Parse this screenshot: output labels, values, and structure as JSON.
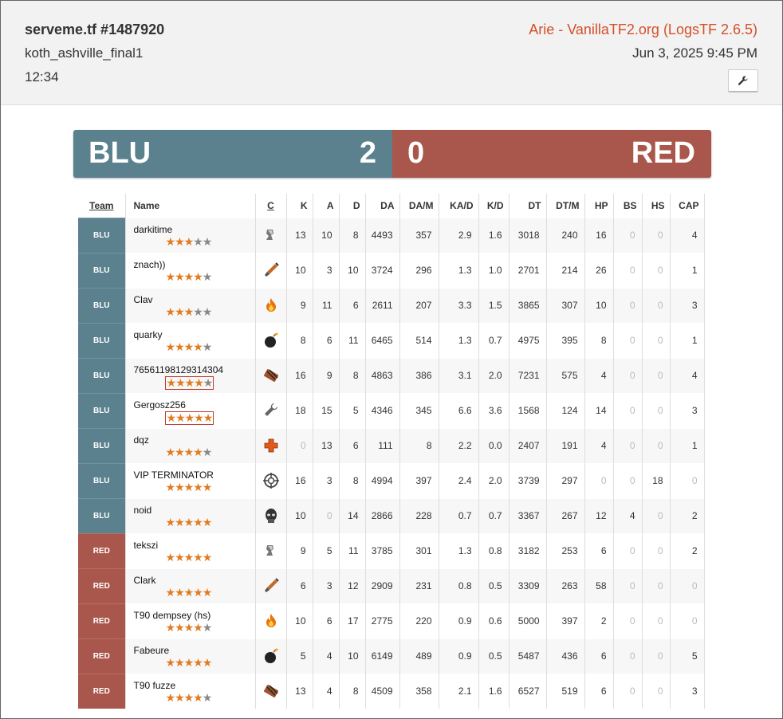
{
  "header": {
    "server": "serveme.tf #1487920",
    "map": "koth_ashville_final1",
    "duration": "12:34",
    "uploader": "Arie - VanillaTF2.org (LogsTF 2.6.5)",
    "date": "Jun 3, 2025 9:45 PM",
    "tool_icon": "wrench-icon"
  },
  "score": {
    "blu_name": "BLU",
    "blu_score": "2",
    "red_score": "0",
    "red_name": "RED",
    "blu_color": "#5b818f",
    "red_color": "#a9574c"
  },
  "columns": [
    "Team",
    "Name",
    "C",
    "K",
    "A",
    "D",
    "DA",
    "DA/M",
    "KA/D",
    "K/D",
    "DT",
    "DT/M",
    "HP",
    "BS",
    "HS",
    "CAP"
  ],
  "players": [
    {
      "team": "BLU",
      "name": "darkitime",
      "rating": 3,
      "boxed": false,
      "class": "scout",
      "stats": [
        "13",
        "10",
        "8",
        "4493",
        "357",
        "2.9",
        "1.6",
        "3018",
        "240",
        "16",
        "0",
        "0",
        "4"
      ]
    },
    {
      "team": "BLU",
      "name": "znach))",
      "rating": 4,
      "boxed": false,
      "class": "soldier",
      "stats": [
        "10",
        "3",
        "10",
        "3724",
        "296",
        "1.3",
        "1.0",
        "2701",
        "214",
        "26",
        "0",
        "0",
        "1"
      ]
    },
    {
      "team": "BLU",
      "name": "Clav",
      "rating": 3,
      "boxed": false,
      "class": "pyro",
      "stats": [
        "9",
        "11",
        "6",
        "2611",
        "207",
        "3.3",
        "1.5",
        "3865",
        "307",
        "10",
        "0",
        "0",
        "3"
      ]
    },
    {
      "team": "BLU",
      "name": "quarky",
      "rating": 4,
      "boxed": false,
      "class": "demoman",
      "stats": [
        "8",
        "6",
        "11",
        "6465",
        "514",
        "1.3",
        "0.7",
        "4975",
        "395",
        "8",
        "0",
        "0",
        "1"
      ]
    },
    {
      "team": "BLU",
      "name": "76561198129314304",
      "rating": 4,
      "boxed": true,
      "class": "heavy",
      "stats": [
        "16",
        "9",
        "8",
        "4863",
        "386",
        "3.1",
        "2.0",
        "7231",
        "575",
        "4",
        "0",
        "0",
        "4"
      ]
    },
    {
      "team": "BLU",
      "name": "Gergosz256",
      "rating": 5,
      "boxed": true,
      "class": "engineer",
      "stats": [
        "18",
        "15",
        "5",
        "4346",
        "345",
        "6.6",
        "3.6",
        "1568",
        "124",
        "14",
        "0",
        "0",
        "3"
      ]
    },
    {
      "team": "BLU",
      "name": "dqz",
      "rating": 4,
      "boxed": false,
      "class": "medic",
      "stats": [
        "0",
        "13",
        "6",
        "111",
        "8",
        "2.2",
        "0.0",
        "2407",
        "191",
        "4",
        "0",
        "0",
        "1"
      ]
    },
    {
      "team": "BLU",
      "name": "VIP TERMINATOR",
      "rating": 5,
      "boxed": false,
      "class": "sniper",
      "stats": [
        "16",
        "3",
        "8",
        "4994",
        "397",
        "2.4",
        "2.0",
        "3739",
        "297",
        "0",
        "0",
        "18",
        "0"
      ]
    },
    {
      "team": "BLU",
      "name": "noid",
      "rating": 5,
      "boxed": false,
      "class": "spy",
      "stats": [
        "10",
        "0",
        "14",
        "2866",
        "228",
        "0.7",
        "0.7",
        "3367",
        "267",
        "12",
        "4",
        "0",
        "2"
      ]
    },
    {
      "team": "RED",
      "name": "tekszi",
      "rating": 5,
      "boxed": false,
      "class": "scout",
      "stats": [
        "9",
        "5",
        "11",
        "3785",
        "301",
        "1.3",
        "0.8",
        "3182",
        "253",
        "6",
        "0",
        "0",
        "2"
      ]
    },
    {
      "team": "RED",
      "name": "Clark",
      "rating": 5,
      "boxed": false,
      "class": "soldier",
      "stats": [
        "6",
        "3",
        "12",
        "2909",
        "231",
        "0.8",
        "0.5",
        "3309",
        "263",
        "58",
        "0",
        "0",
        "0"
      ]
    },
    {
      "team": "RED",
      "name": "T90 dempsey (hs)",
      "rating": 4,
      "boxed": false,
      "class": "pyro",
      "stats": [
        "10",
        "6",
        "17",
        "2775",
        "220",
        "0.9",
        "0.6",
        "5000",
        "397",
        "2",
        "0",
        "0",
        "0"
      ]
    },
    {
      "team": "RED",
      "name": "Fabeure",
      "rating": 5,
      "boxed": false,
      "class": "demoman",
      "stats": [
        "5",
        "4",
        "10",
        "6149",
        "489",
        "0.9",
        "0.5",
        "5487",
        "436",
        "6",
        "0",
        "0",
        "5"
      ]
    },
    {
      "team": "RED",
      "name": "T90 fuzze",
      "rating": 4,
      "boxed": false,
      "class": "heavy",
      "stats": [
        "13",
        "4",
        "8",
        "4509",
        "358",
        "2.1",
        "1.6",
        "6527",
        "519",
        "6",
        "0",
        "0",
        "3"
      ]
    }
  ]
}
